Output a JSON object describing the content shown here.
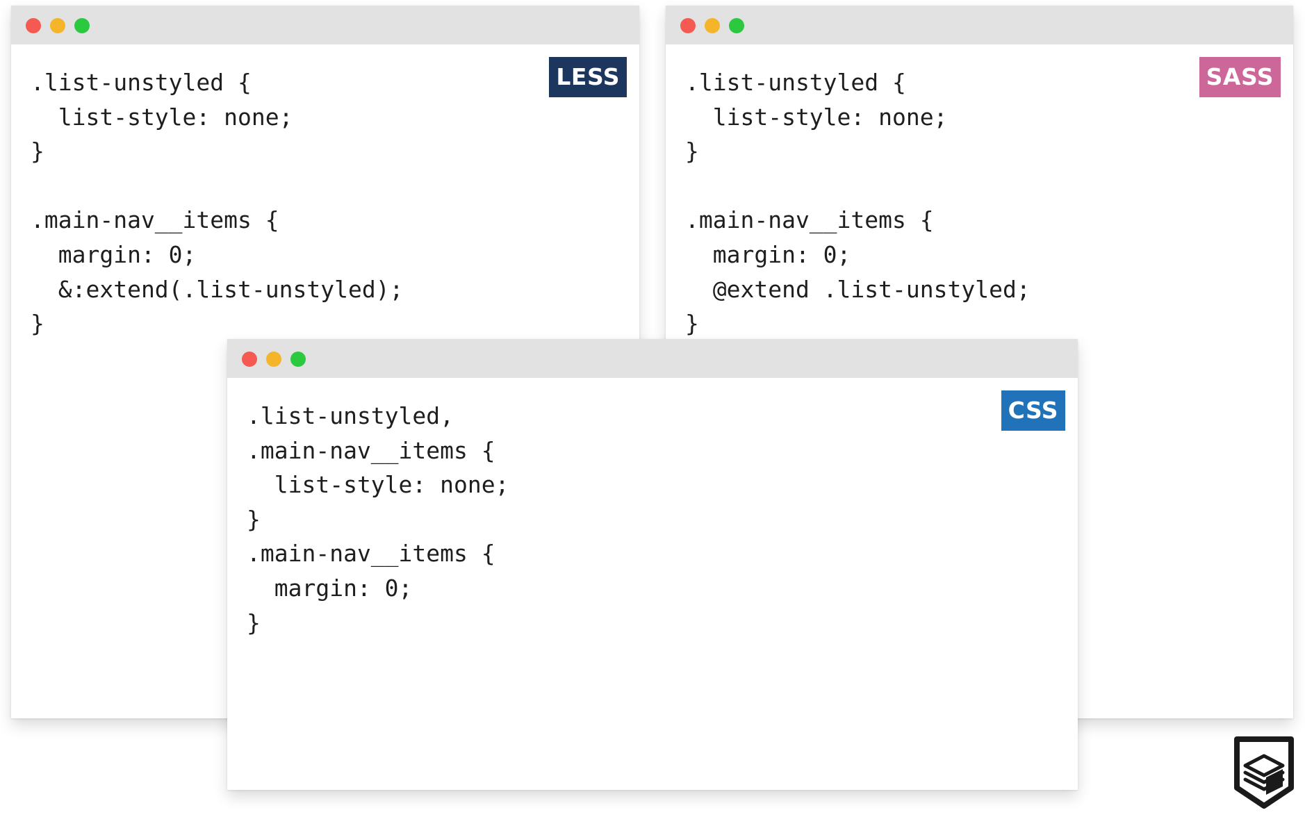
{
  "colors": {
    "titlebar": "#e2e2e2",
    "close": "#f45a52",
    "minimize": "#f5b52a",
    "maximize": "#2bc940",
    "less_badge": "#1d365d",
    "sass_badge": "#cd6799",
    "css_badge": "#2073b8",
    "code_text": "#1e1e1e",
    "logo_stroke": "#1a1a1a"
  },
  "windows": {
    "less": {
      "badge": "LESS",
      "lines": [
        ".list-unstyled {",
        "  list-style: none;",
        "}",
        "",
        ".main-nav__items {",
        "  margin: 0;",
        "  &:extend(.list-unstyled);",
        "}"
      ]
    },
    "sass": {
      "badge": "SASS",
      "lines": [
        ".list-unstyled {",
        "  list-style: none;",
        "}",
        "",
        ".main-nav__items {",
        "  margin: 0;",
        "  @extend .list-unstyled;",
        "}"
      ]
    },
    "css": {
      "badge": "CSS",
      "lines": [
        ".list-unstyled,",
        ".main-nav__items {",
        "  list-style: none;",
        "}",
        ".main-nav__items {",
        "  margin: 0;",
        "}"
      ]
    }
  },
  "logo": {
    "icon": "stacked-layers-shield-icon"
  }
}
